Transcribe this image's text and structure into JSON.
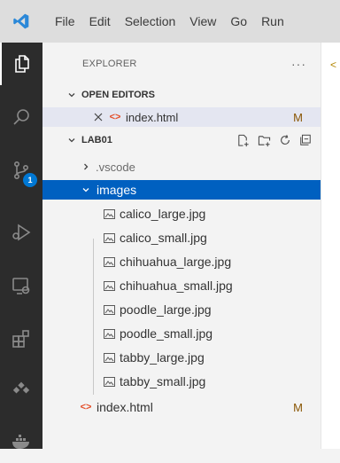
{
  "menu": [
    "File",
    "Edit",
    "Selection",
    "View",
    "Go",
    "Run"
  ],
  "activity_bar": {
    "items": [
      "explorer-icon",
      "search-icon",
      "source-control-icon",
      "run-debug-icon",
      "remote-explorer-icon",
      "extensions-icon",
      "testing-icon",
      "docker-icon"
    ],
    "source_control_badge": "1"
  },
  "explorer": {
    "title": "EXPLORER",
    "more": "···",
    "open_editors": {
      "label": "OPEN EDITORS",
      "items": [
        {
          "name": "index.html",
          "status": "M"
        }
      ]
    },
    "workspace": {
      "label": "LAB01",
      "tree": [
        {
          "name": ".vscode",
          "type": "folder",
          "expanded": false
        },
        {
          "name": "images",
          "type": "folder",
          "expanded": true,
          "selected": true
        },
        {
          "name": "calico_large.jpg",
          "type": "image"
        },
        {
          "name": "calico_small.jpg",
          "type": "image"
        },
        {
          "name": "chihuahua_large.jpg",
          "type": "image"
        },
        {
          "name": "chihuahua_small.jpg",
          "type": "image"
        },
        {
          "name": "poodle_large.jpg",
          "type": "image"
        },
        {
          "name": "poodle_small.jpg",
          "type": "image"
        },
        {
          "name": "tabby_large.jpg",
          "type": "image"
        },
        {
          "name": "tabby_small.jpg",
          "type": "image"
        },
        {
          "name": "index.html",
          "type": "html",
          "status": "M"
        }
      ]
    }
  },
  "colors": {
    "selection": "#0060c0",
    "activity_bar": "#2c2c2c",
    "modified": "#895503",
    "badge": "#0078d4",
    "vscode_logo": "#2b88d8"
  }
}
